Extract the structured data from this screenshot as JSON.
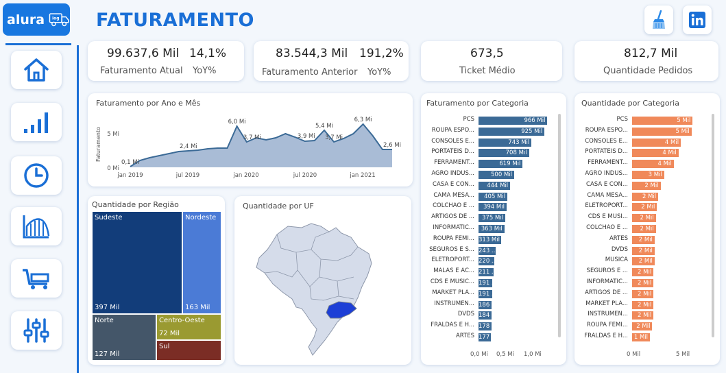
{
  "brand": {
    "name": "alura",
    "badge": "log"
  },
  "page_title": "FATURAMENTO",
  "kpis": {
    "faturamento_atual": {
      "value": "99.637,6 Mil",
      "label": "Faturamento Atual",
      "yoy_value": "14,1%",
      "yoy_label": "YoY%"
    },
    "faturamento_anterior": {
      "value": "83.544,3 Mil",
      "label": "Faturamento Anterior",
      "yoy_value": "191,2%",
      "yoy_label": "YoY%"
    },
    "ticket_medio": {
      "value": "673,5",
      "label": "Ticket Médio"
    },
    "quantidade_pedidos": {
      "value": "812,7 Mil",
      "label": "Quantidade Pedidos"
    }
  },
  "line_card": {
    "title": "Faturamento por Ano e Mês",
    "ylabel": "Faturamento",
    "yticks": [
      "5 Mi",
      "0 Mi"
    ],
    "xticks": [
      "jan 2019",
      "jul 2019",
      "jan 2020",
      "jul 2020",
      "jan 2021"
    ],
    "data_labels": [
      "0,1 Mi",
      "2,4 Mi",
      "6,0 Mi",
      "3,7 Mi",
      "5,4 Mi",
      "3,9 Mi",
      "3,7 Mi",
      "6,3 Mi",
      "2,6 Mi"
    ]
  },
  "chart_data": [
    {
      "type": "area",
      "title": "Faturamento por Ano e Mês",
      "ylabel": "Faturamento",
      "ylim": [
        0,
        7
      ],
      "x": [
        "jan 2019",
        "fev 2019",
        "mar 2019",
        "abr 2019",
        "mai 2019",
        "jun 2019",
        "jul 2019",
        "ago 2019",
        "set 2019",
        "out 2019",
        "nov 2019",
        "dez 2019",
        "jan 2020",
        "fev 2020",
        "mar 2020",
        "abr 2020",
        "mai 2020",
        "jun 2020",
        "jul 2020",
        "ago 2020",
        "set 2020",
        "out 2020",
        "nov 2020",
        "dez 2020",
        "jan 2021",
        "fev 2021",
        "mar 2021",
        "abr 2021"
      ],
      "values": [
        0.1,
        1.0,
        1.4,
        1.7,
        2.0,
        2.3,
        2.4,
        2.5,
        2.7,
        2.8,
        2.8,
        6.0,
        3.7,
        4.3,
        4.0,
        4.3,
        4.9,
        4.4,
        3.8,
        3.9,
        5.4,
        3.7,
        4.2,
        4.9,
        6.3,
        4.6,
        2.6,
        2.6
      ]
    },
    {
      "type": "bar",
      "title": "Faturamento por Categoria",
      "categories": [
        "PCS",
        "ROUPA ESPO...",
        "CONSOLES E...",
        "PORTATEIS D...",
        "FERRAMENT...",
        "AGRO INDUS...",
        "CASA E CON...",
        "CAMA MESA...",
        "COLCHAO E ...",
        "ARTIGOS DE ...",
        "INFORMATIC...",
        "ROUPA FEMI...",
        "SEGUROS E S...",
        "ELETROPORT...",
        "MALAS E AC...",
        "CDS E MUSIC...",
        "MARKET PLA...",
        "INSTRUMEN...",
        "DVDS",
        "FRALDAS E H...",
        "ARTES"
      ],
      "values": [
        966,
        925,
        743,
        708,
        619,
        500,
        444,
        405,
        394,
        375,
        363,
        313,
        243,
        220,
        211,
        191,
        191,
        186,
        184,
        178,
        177
      ],
      "value_labels": [
        "966 Mil",
        "925 Mil",
        "743 Mil",
        "708 Mil",
        "619 Mil",
        "500 Mil",
        "444 Mil",
        "405 Mil",
        "394 Mil",
        "375 Mil",
        "363 Mil",
        "313 Mil",
        "243 ...",
        "220 ...",
        "211 ...",
        "191 ...",
        "191 ...",
        "186 ...",
        "184 ...",
        "178 ...",
        "177 ..."
      ],
      "xticks": [
        "0,0 Mi",
        "0,5 Mi",
        "1,0 Mi"
      ],
      "xlim": [
        0,
        1000
      ],
      "color": "#3b6a96"
    },
    {
      "type": "bar",
      "title": "Quantidade por Categoria",
      "categories": [
        "PCS",
        "ROUPA ESPO...",
        "CONSOLES E...",
        "PORTATEIS D...",
        "FERRAMENT...",
        "AGRO INDUS...",
        "CASA E CON...",
        "CAMA MESA...",
        "ELETROPORT...",
        "CDS E MUSI...",
        "COLCHAO E ...",
        "ARTES",
        "DVDS",
        "MUSICA",
        "SEGUROS E ...",
        "INFORMATIC...",
        "ARTIGOS DE ...",
        "MARKET PLA...",
        "INSTRUMEN...",
        "ROUPA FEMI...",
        "FRALDAS E H..."
      ],
      "values": [
        5,
        5,
        4,
        4,
        4,
        3,
        2,
        2,
        2,
        2,
        2,
        2,
        2,
        2,
        2,
        2,
        2,
        2,
        2,
        2,
        1
      ],
      "value_labels": [
        "5 Mil",
        "5 Mil",
        "4 Mil",
        "4 Mil",
        "4 Mil",
        "3 Mil",
        "2 Mil",
        "2 Mil",
        "2 Mil",
        "2 Mil",
        "2 Mil",
        "2 Mil",
        "2 Mil",
        "2 Mil",
        "2 Mil",
        "2 Mil",
        "2 Mil",
        "2 Mil",
        "2 Mil",
        "2 Mil",
        "1 Mil"
      ],
      "bar_scale": [
        5.1,
        5.0,
        4.1,
        3.9,
        3.5,
        2.7,
        2.4,
        2.2,
        2.1,
        2.0,
        2.0,
        1.9,
        1.9,
        1.9,
        1.8,
        1.8,
        1.8,
        1.8,
        1.8,
        1.7,
        1.5
      ],
      "xticks": [
        "0 Mil",
        "5 Mil"
      ],
      "xlim": [
        0,
        6
      ],
      "color": "#f0895a"
    },
    {
      "type": "treemap",
      "title": "Quantidade por Região",
      "categories": [
        "Sudeste",
        "Nordeste",
        "Norte",
        "Centro-Oeste",
        "Sul"
      ],
      "value_labels": [
        "397 Mil",
        "163 Mil",
        "127 Mil",
        "72 Mil",
        ""
      ],
      "colors": [
        "#123d7a",
        "#4b7bd6",
        "#445669",
        "#9a9a31",
        "#7b2d25"
      ]
    }
  ],
  "map_card": {
    "title": "Quantidade por UF"
  },
  "icons": [
    "brush-icon",
    "linkedin-icon",
    "home-icon",
    "bar-chart-icon",
    "clock-icon",
    "area-chart-icon",
    "truck-icon",
    "sliders-icon"
  ]
}
